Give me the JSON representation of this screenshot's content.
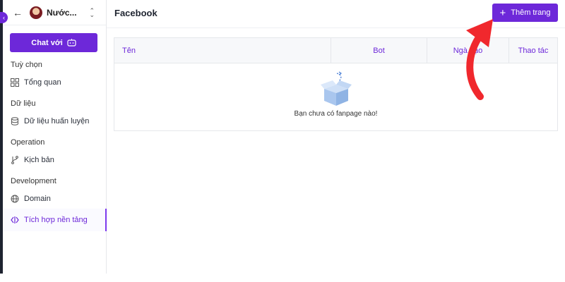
{
  "sidebar": {
    "workspace_name": "Nước...",
    "chat_button": "Chat với",
    "sections": [
      {
        "title": "Tuỳ chọn",
        "items": [
          {
            "label": "Tổng quan",
            "icon": "dashboard-icon"
          }
        ]
      },
      {
        "title": "Dữ liệu",
        "items": [
          {
            "label": "Dữ liệu huấn luyện",
            "icon": "database-icon"
          }
        ]
      },
      {
        "title": "Operation",
        "items": [
          {
            "label": "Kịch bản",
            "icon": "branch-icon"
          }
        ]
      },
      {
        "title": "Development",
        "items": [
          {
            "label": "Domain",
            "icon": "globe-icon"
          }
        ]
      }
    ],
    "active_item": {
      "label": "Tích hợp nền tảng",
      "icon": "integration-icon"
    }
  },
  "header": {
    "title": "Facebook",
    "add_button": "Thêm trang"
  },
  "table": {
    "columns": [
      "Tên",
      "Bot",
      "Ngà...ạo",
      "Thao tác"
    ],
    "empty_message": "Bạn chưa có fanpage nào!"
  },
  "colors": {
    "accent": "#6d28d9",
    "annotation_arrow": "#f0282d"
  }
}
